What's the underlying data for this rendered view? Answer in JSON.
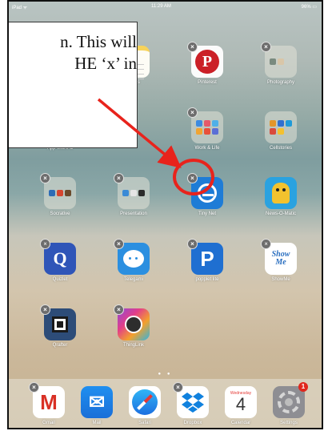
{
  "status_bar": {
    "carrier": "iPad ᯤ",
    "time": "11:29 AM",
    "battery": "96% ▭"
  },
  "callout": {
    "text": "n. This will\nHE ‘x’ in"
  },
  "apps": [
    {
      "label": "Notes",
      "icon": "notes-icon"
    },
    {
      "label": "Pinterest",
      "icon": "pinterest-icon"
    },
    {
      "label": "Photography",
      "icon": "folder-icon"
    },
    {
      "label": "App Store &",
      "icon": "folder-icon"
    },
    {
      "label": "Work & Life",
      "icon": "folder-icon"
    },
    {
      "label": "Cellstories",
      "icon": "folder-icon"
    },
    {
      "label": "Socrative",
      "icon": "folder-icon"
    },
    {
      "label": "Presentation",
      "icon": "folder-icon"
    },
    {
      "label": "Tiny Net",
      "icon": "tinynet-icon"
    },
    {
      "label": "News-O-Matic",
      "icon": "news-o-matic-icon"
    },
    {
      "label": "Quizlet",
      "icon": "quizlet-icon"
    },
    {
      "label": "Telegami",
      "icon": "telegami-icon"
    },
    {
      "label": "popplet lite",
      "icon": "popplet-icon"
    },
    {
      "label": "ShowMe",
      "icon": "showme-icon"
    },
    {
      "label": "Qrafter",
      "icon": "qrafter-icon"
    },
    {
      "label": "ThingLink",
      "icon": "thinglink-icon"
    }
  ],
  "page_dots": "● ●",
  "dock": [
    {
      "label": "Gmail",
      "icon": "gmail-icon"
    },
    {
      "label": "Mail",
      "icon": "mail-icon"
    },
    {
      "label": "Safari",
      "icon": "safari-icon"
    },
    {
      "label": "Dropbox",
      "icon": "dropbox-icon"
    },
    {
      "label": "Calendar",
      "icon": "calendar-icon",
      "weekday": "Wednesday",
      "day": "4"
    },
    {
      "label": "Settings",
      "icon": "settings-icon",
      "badge": "1"
    }
  ],
  "delete_glyph": "×",
  "glyphs": {
    "pinterest": "P",
    "quizlet": "Q",
    "popplet": "P",
    "showme": "Show\nMe",
    "gmail": "M",
    "mail": "✉"
  },
  "colors": {
    "annotation": "#e8231c"
  }
}
